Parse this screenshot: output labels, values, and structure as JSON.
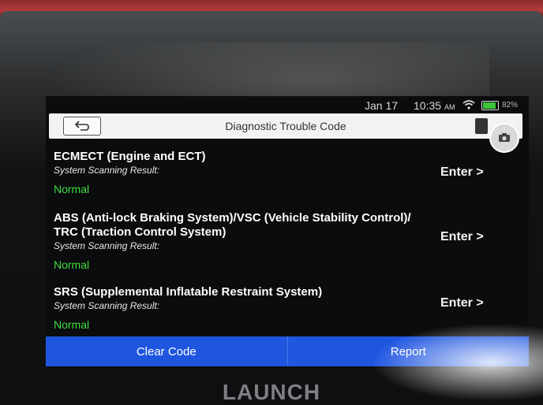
{
  "status_bar": {
    "date": "Jan 17",
    "time": "10:35",
    "time_suffix": "AM",
    "battery": "82%"
  },
  "header": {
    "title": "Diagnostic Trouble Code"
  },
  "systems": [
    {
      "name": "ECMECT (Engine and ECT)",
      "result_label": "System Scanning Result:",
      "result": "Normal",
      "action": "Enter >"
    },
    {
      "name": "ABS (Anti-lock Braking System)/VSC (Vehicle Stability Control)/ TRC (Traction Control System)",
      "result_label": "System Scanning Result:",
      "result": "Normal",
      "action": "Enter >"
    },
    {
      "name": "SRS (Supplemental Inflatable Restraint System)",
      "result_label": "System Scanning Result:",
      "result": "Normal",
      "action": "Enter >"
    }
  ],
  "footer": {
    "clear_label": "Clear Code",
    "report_label": "Report"
  },
  "brand": "LAUNCH",
  "colors": {
    "accent": "#1f56e0",
    "status_normal": "#3ede3e"
  }
}
